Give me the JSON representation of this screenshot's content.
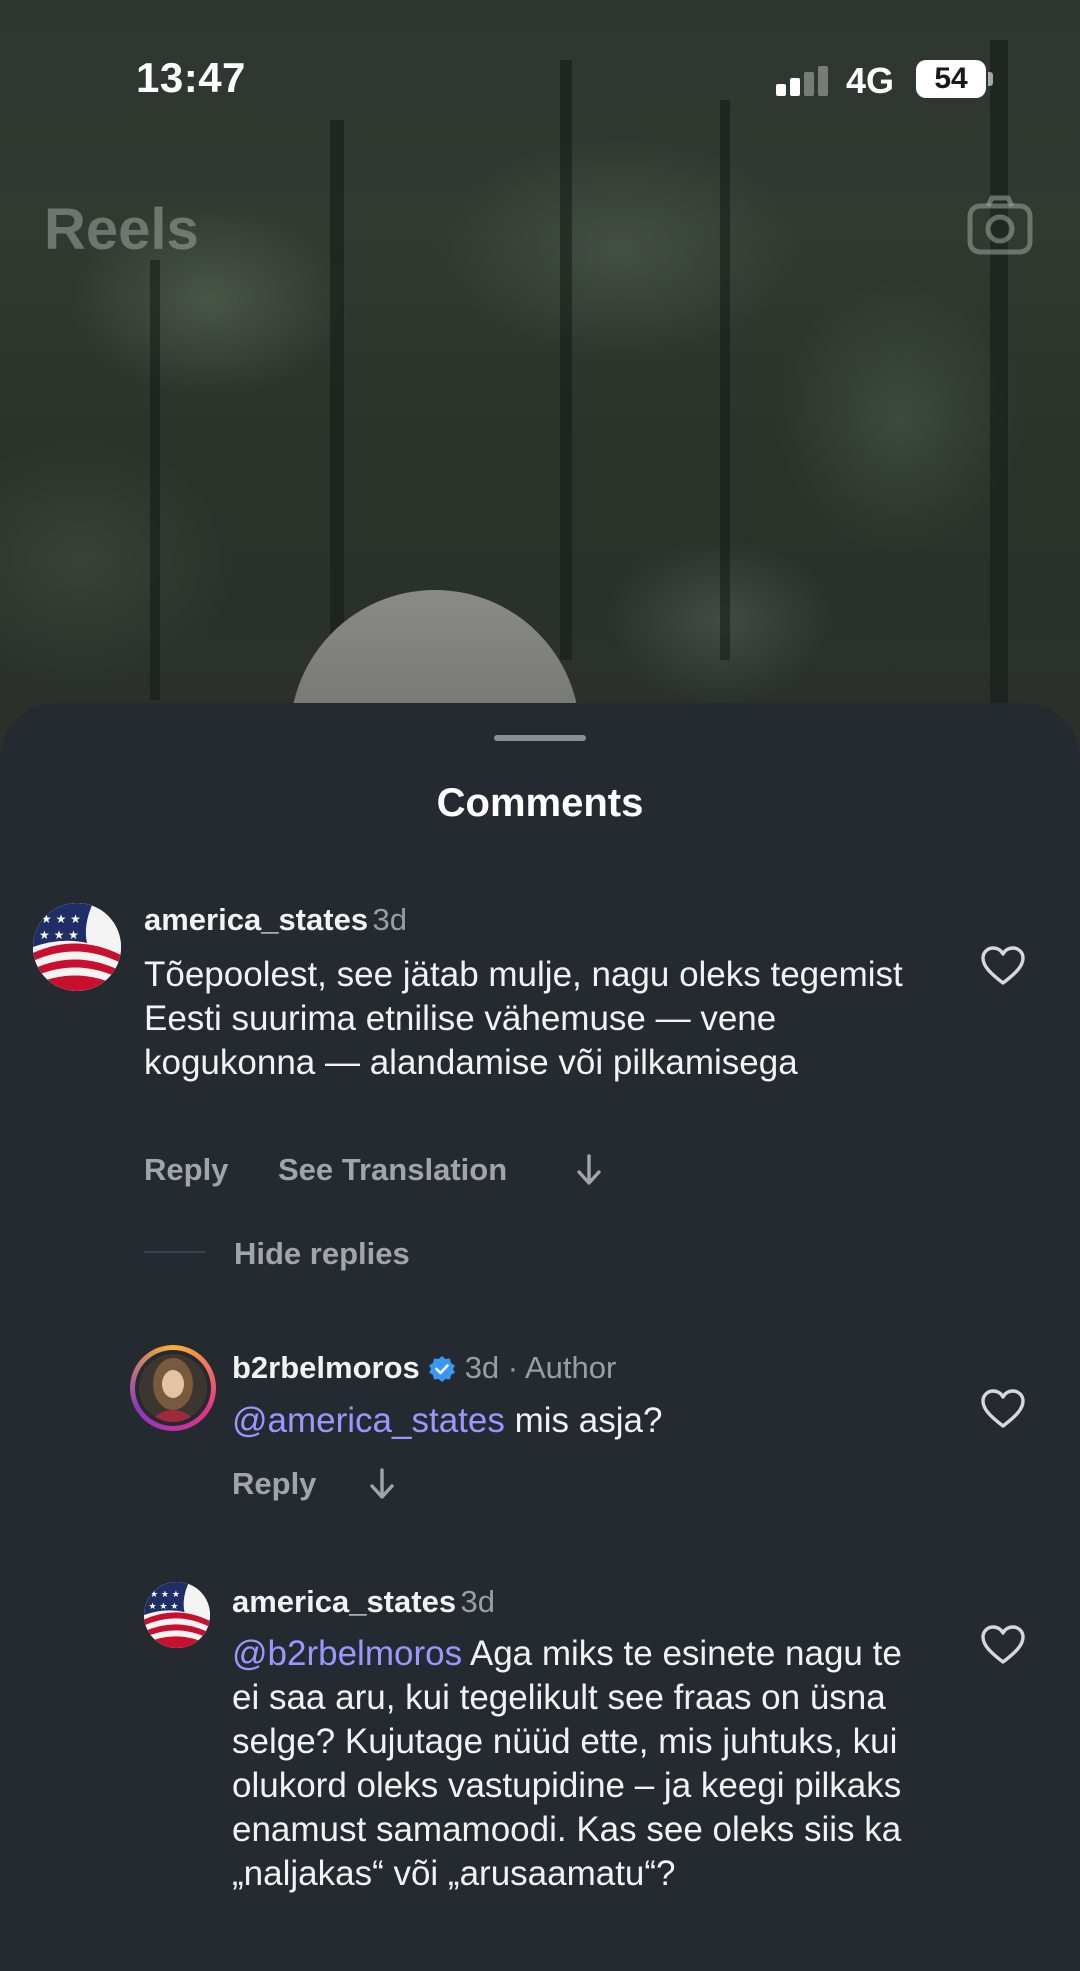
{
  "status_bar": {
    "time": "13:47",
    "network": "4G",
    "battery": "54"
  },
  "header": {
    "title": "Reels"
  },
  "sheet": {
    "title": "Comments"
  },
  "comments": [
    {
      "username": "america_states",
      "time": "3d",
      "text": "Tõepoolest, see jätab mulje, nagu oleks tegemist Eesti suurima etnilise vähemuse — vene kogukonna — alandamise või pilkamisega",
      "actions": {
        "reply": "Reply",
        "translate": "See Translation"
      }
    }
  ],
  "hide_replies": "Hide replies",
  "replies": [
    {
      "username": "b2rbelmoros",
      "meta": "3d · Author",
      "mention": "@america_states",
      "text": " mis asja?",
      "actions": {
        "reply": "Reply"
      }
    },
    {
      "username": "america_states",
      "time": "3d",
      "mention": "@b2rbelmoros",
      "text": " Aga miks te esinete nagu te ei saa aru, kui tegelikult see fraas on üsna selge? Kujutage nüüd ette, mis juhtuks, kui olukord oleks vastupidine – ja keegi pilkaks enamust samamoodi. Kas see oleks siis ka „naljakas“ või „arusaamatu“?"
    }
  ],
  "icons": {
    "camera": "camera-icon",
    "heart": "heart-outline-icon",
    "verified": "verified-badge-icon",
    "translate_arrow": "down-arrow-icon"
  },
  "colors": {
    "sheet_bg": "#252a31",
    "mention": "#9a97ff",
    "verified": "#3897f0",
    "secondary_text": "#9a9ea4"
  }
}
